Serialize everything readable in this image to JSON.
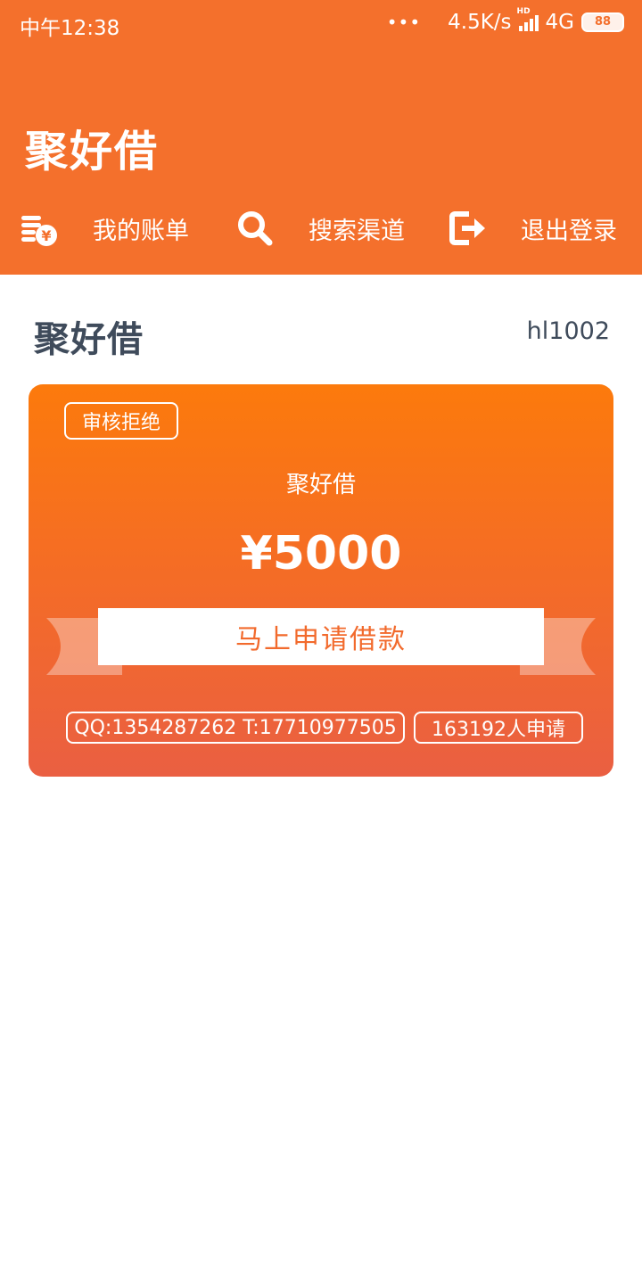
{
  "status_bar": {
    "time": "中午12:38",
    "dots": "•••",
    "network_speed": "4.5K/s",
    "hd_label": "HD",
    "network_type": "4G",
    "battery_level": "88"
  },
  "header": {
    "app_title": "聚好借",
    "nav": [
      {
        "label": "我的账单",
        "icon": "bill-yen-icon"
      },
      {
        "label": "搜索渠道",
        "icon": "search-icon"
      },
      {
        "label": "退出登录",
        "icon": "logout-icon"
      }
    ]
  },
  "main": {
    "title": "聚好借",
    "user_id": "hl1002",
    "card": {
      "status_tag": "审核拒绝",
      "product_name": "聚好借",
      "amount": "¥5000",
      "apply_button": "马上申请借款",
      "contact": "QQ:1354287262 T:17710977505",
      "applicants": "163192人申请"
    }
  },
  "colors": {
    "header_bg": "#f4702c",
    "card_top": "#fc7a0c",
    "card_bottom": "#ea5f42",
    "title_text": "#3f4b5b",
    "button_text": "#f26a2c"
  }
}
